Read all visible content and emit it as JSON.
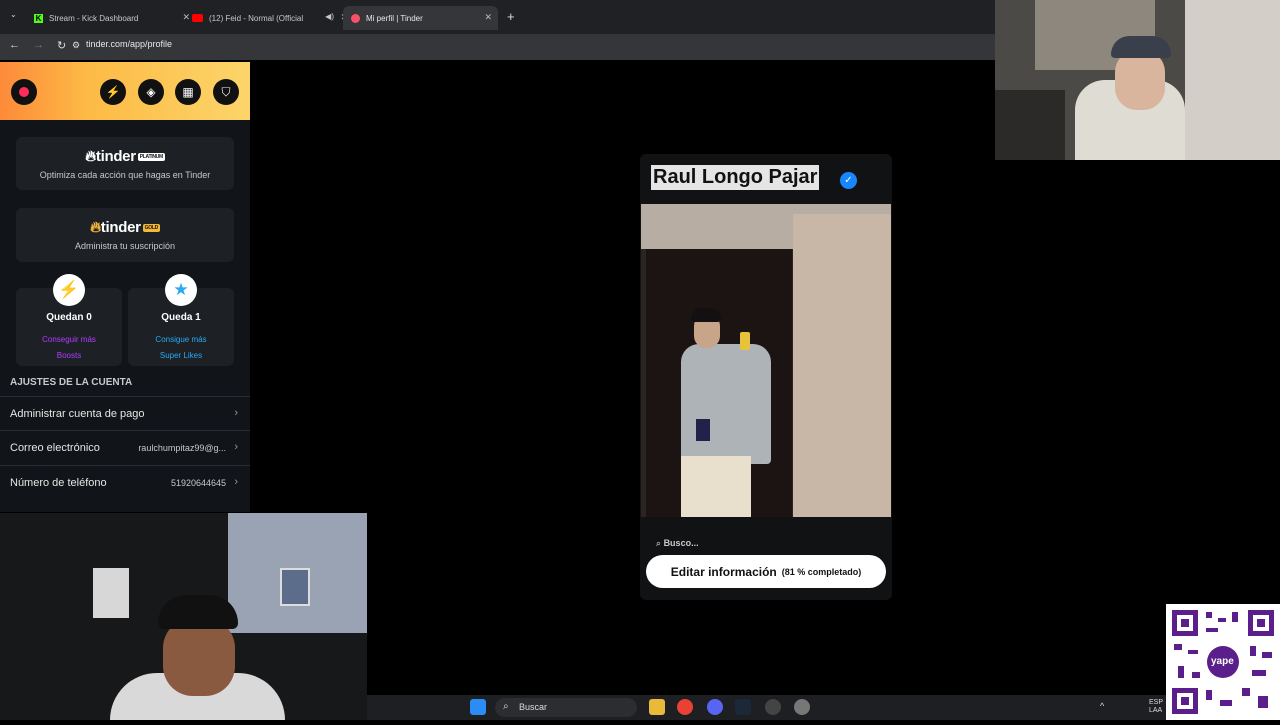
{
  "browser": {
    "tabs": [
      {
        "title": "Stream - Kick Dashboard",
        "favicon": "kick-icon",
        "active": false
      },
      {
        "title": "(12) Feid - Normal (Official",
        "favicon": "youtube-icon",
        "active": false
      },
      {
        "title": "Mi perfil | Tinder",
        "favicon": "tinder-icon",
        "active": true
      }
    ],
    "url": "tinder.com/app/profile"
  },
  "sidebar": {
    "header_icons": [
      "tinder-flame-icon",
      "boost-icon",
      "explore-icon",
      "briefcase-icon",
      "shield-icon"
    ],
    "platinum": {
      "brand": "tinder",
      "tag": "PLATINUM",
      "subtitle": "Optimiza cada acción que hagas en Tinder"
    },
    "gold": {
      "brand": "tinder",
      "tag": "GOLD",
      "subtitle": "Administra tu suscripción"
    },
    "boosts": {
      "count": "Quedan 0",
      "link_line1": "Conseguir más",
      "link_line2": "Boosts",
      "color": "#b43cff"
    },
    "superlikes": {
      "count": "Queda 1",
      "link_line1": "Consigue más",
      "link_line2": "Super Likes",
      "color": "#28a8f5"
    },
    "account_title": "AJUSTES DE LA CUENTA",
    "rows": [
      {
        "label": "Administrar cuenta de pago",
        "value": ""
      },
      {
        "label": "Correo electrónico",
        "value": "raulchumpitaz99@g..."
      },
      {
        "label": "Número de teléfono",
        "value": "51920644645"
      }
    ]
  },
  "profile": {
    "name": "Raul Longo Pajar",
    "verified": true,
    "search_label": "Busco...",
    "edit_button": "Editar información",
    "completion": "(81 % completado)"
  },
  "taskbar": {
    "search_placeholder": "Buscar",
    "tray_lang1": "ESP",
    "tray_lang2": "LAA"
  },
  "qr": {
    "label": "yape"
  }
}
